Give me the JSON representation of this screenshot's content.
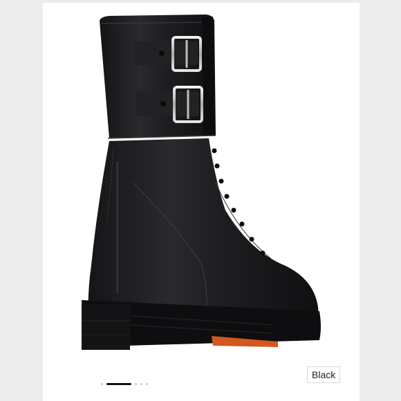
{
  "listing": {
    "color_label": "Black",
    "favorite_icon": "heart-outline-icon",
    "carousel": {
      "total": 5,
      "active_index": 1
    }
  },
  "colors": {
    "background": "#ececec",
    "card": "#ffffff",
    "boot": "#1c1c1e",
    "sole_accent": "#d2581f",
    "buckle": "#c9c9c9"
  }
}
